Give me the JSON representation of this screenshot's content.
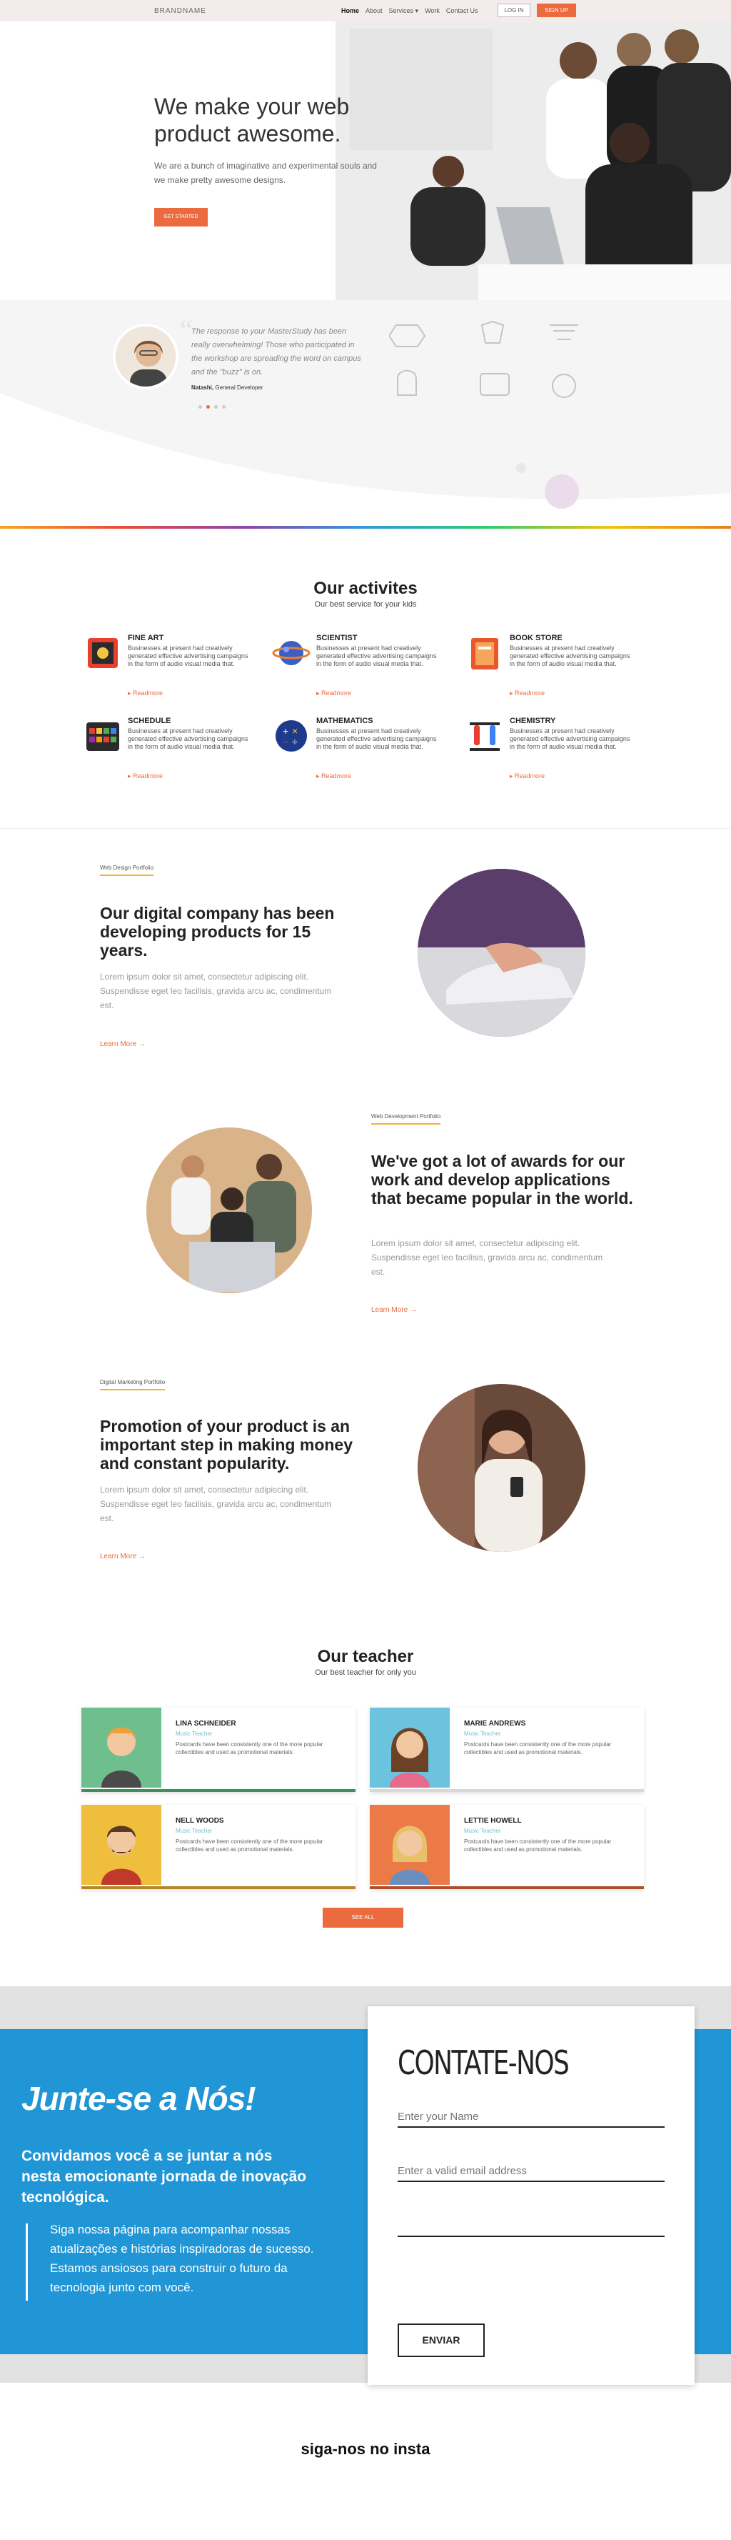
{
  "nav": {
    "brand": "BRANDNAME",
    "links": [
      "Home",
      "About",
      "Services ▾",
      "Work",
      "Contact Us"
    ],
    "login": "LOG IN",
    "signup": "SIGN UP"
  },
  "hero": {
    "title": "We make your web product awesome.",
    "subtitle": "We are a bunch of imaginative and experimental souls and we make pretty awesome designs.",
    "button": "GET STARTED"
  },
  "testimonial": {
    "quote": "The response to your MasterStudy has been really overwhelming! Those who participated in the workshop are spreading the word on campus and the \"buzz\" is on.",
    "name": "Natashi,",
    "role": "General Developer"
  },
  "activities": {
    "title": "Our activites",
    "subtitle": "Our best service for your kids",
    "items": [
      {
        "title": "FINE ART",
        "text": "Businesses at present had creatively generated effective advertising campaigns in the form of audio visual media that.",
        "more": "▸ Readmore",
        "icon": "paint-palette-icon"
      },
      {
        "title": "SCIENTIST",
        "text": "Businesses at present had creatively generated effective advertising campaigns in the form of audio visual media that.",
        "more": "▸ Readmore",
        "icon": "planet-icon"
      },
      {
        "title": "BOOK STORE",
        "text": "Businesses at present had creatively generated effective advertising campaigns in the form of audio visual media that.",
        "more": "▸ Readmore",
        "icon": "book-icon"
      },
      {
        "title": "SCHEDULE",
        "text": "Businesses at present had creatively generated effective advertising campaigns in the form of audio visual media that.",
        "more": "▸ Readmore",
        "icon": "calendar-icon"
      },
      {
        "title": "MATHEMATICS",
        "text": "Businesses at present had creatively generated effective advertising campaigns in the form of audio visual media that.",
        "more": "▸ Readmore",
        "icon": "math-symbols-icon"
      },
      {
        "title": "CHEMISTRY",
        "text": "Businesses at present had creatively generated effective advertising campaigns in the form of audio visual media that.",
        "more": "▸ Readmore",
        "icon": "flask-icon"
      }
    ]
  },
  "portfolio": [
    {
      "tag": "Web Design Portfolio",
      "title": "Our digital company has been developing products for 15 years.",
      "text": "Lorem ipsum dolor sit amet, consectetur adipiscing elit. Suspendisse eget leo facilisis, gravida arcu ac, condimentum est.",
      "link": "Learn More →"
    },
    {
      "tag": "Web Development Portfolio",
      "title": "We've got a lot of awards for our work and develop applications that became popular in the world.",
      "text": "Lorem ipsum dolor sit amet, consectetur adipiscing elit. Suspendisse eget leo facilisis, gravida arcu ac, condimentum est.",
      "link": "Learn More →"
    },
    {
      "tag": "Digital Marketing Portfolio",
      "title": "Promotion of your product is an important step in making money and constant popularity.",
      "text": "Lorem ipsum dolor sit amet, consectetur adipiscing elit. Suspendisse eget leo facilisis, gravida arcu ac, condimentum est.",
      "link": "Learn More →"
    }
  ],
  "teachers": {
    "title": "Our teacher",
    "subtitle": "Our best teacher for only you",
    "items": [
      {
        "name": "LINA SCHNEIDER",
        "role": "Music Teacher",
        "text": "Postcards have been consistently one of the more popular collectibles and used as promotional materials.",
        "color": "#6fbf8e"
      },
      {
        "name": "MARIE ANDREWS",
        "role": "Music Teacher",
        "text": "Postcards have been consistently one of the more popular collectibles and used as promotional materials.",
        "color": "#6cc3dd"
      },
      {
        "name": "NELL WOODS",
        "role": "Music Teacher",
        "text": "Postcards have been consistently one of the more popular collectibles and used as promotional materials.",
        "color": "#eebe3c"
      },
      {
        "name": "LETTIE HOWELL",
        "role": "Music Teacher",
        "text": "Postcards have been consistently one of the more popular collectibles and used as promotional materials.",
        "color": "#ec7a47"
      }
    ],
    "button": "SEE ALL"
  },
  "join": {
    "title": "Junte-se a Nós!",
    "subtitle": "Convidamos você a se juntar a nós nesta emocionante jornada de inovação tecnológica.",
    "text": "Siga nossa página para acompanhar nossas atualizações e histórias inspiradoras de sucesso. Estamos ansiosos para construir o futuro da tecnologia junto com você."
  },
  "contact": {
    "title": "CONTATE-NOS",
    "name_placeholder": "Enter your Name",
    "email_placeholder": "Enter a valid email address",
    "button": "ENVIAR"
  },
  "footer": {
    "insta": "siga-nos no insta"
  },
  "colors": {
    "accent": "#ec6b3e",
    "blue": "#2196d6"
  }
}
